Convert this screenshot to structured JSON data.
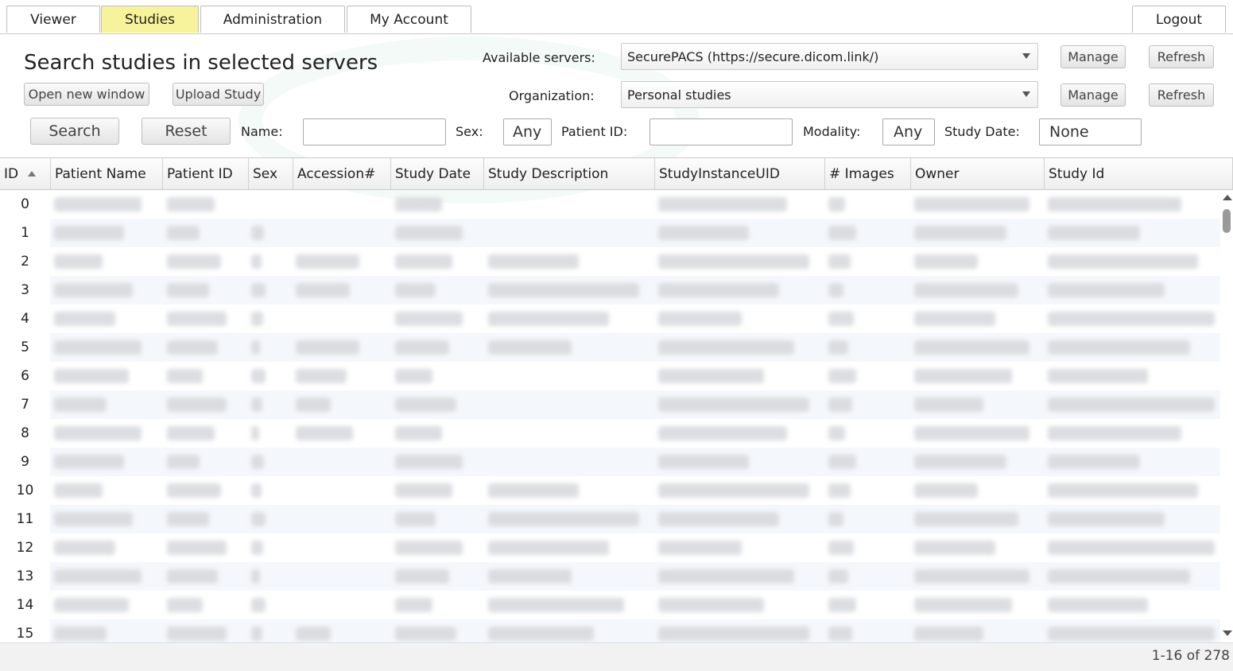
{
  "tabs": [
    "Viewer",
    "Studies",
    "Administration",
    "My Account"
  ],
  "logout_label": "Logout",
  "page_title": "Search studies in selected servers",
  "buttons": {
    "open_new_window": "Open new window",
    "upload_study": "Upload Study",
    "search": "Search",
    "reset": "Reset",
    "manage": "Manage",
    "refresh": "Refresh"
  },
  "servers": {
    "available_label": "Available servers:",
    "available_value": "SecurePACS (https://secure.dicom.link/)",
    "organization_label": "Organization:",
    "organization_value": "Personal studies"
  },
  "filters": {
    "name_label": "Name:",
    "name_value": "",
    "sex_label": "Sex:",
    "sex_value": "Any",
    "patient_id_label": "Patient ID:",
    "patient_id_value": "",
    "modality_label": "Modality:",
    "modality_value": "Any",
    "study_date_label": "Study Date:",
    "study_date_value": "None"
  },
  "columns": [
    "ID",
    "Patient Name",
    "Patient ID",
    "Sex",
    "Accession#",
    "Study Date",
    "Study Description",
    "StudyInstanceUID",
    "# Images",
    "Owner",
    "Study Id"
  ],
  "rows": [
    "0",
    "1",
    "2",
    "3",
    "4",
    "5",
    "6",
    "7",
    "8",
    "9",
    "10",
    "11",
    "12",
    "13",
    "14",
    "15"
  ],
  "pager": "1-16 of 278"
}
